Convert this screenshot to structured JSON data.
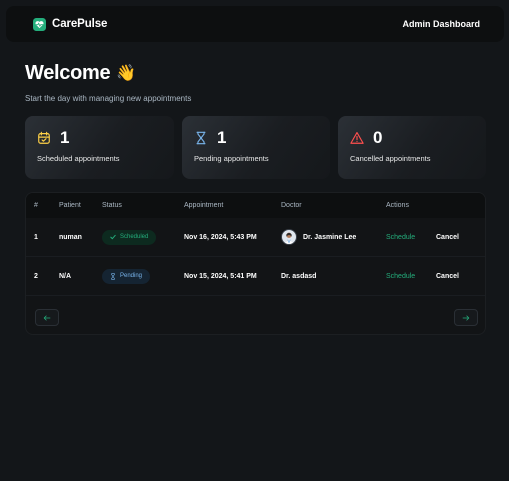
{
  "header": {
    "app_name": "CarePulse",
    "right_title": "Admin Dashboard"
  },
  "welcome": {
    "title": "Welcome",
    "icon": "waving-hand-icon",
    "subtitle": "Start the day with managing new appointments"
  },
  "stats": [
    {
      "icon": "calendar-check-icon",
      "count": "1",
      "label": "Scheduled appointments",
      "color": "#ffd147"
    },
    {
      "icon": "hourglass-icon",
      "count": "1",
      "label": "Pending appointments",
      "color": "#79b5ec"
    },
    {
      "icon": "alert-triangle-icon",
      "count": "0",
      "label": "Cancelled appointments",
      "color": "#ff4f4e"
    }
  ],
  "table": {
    "headers": {
      "num": "#",
      "patient": "Patient",
      "status": "Status",
      "appointment": "Appointment",
      "doctor": "Doctor",
      "actions": "Actions"
    },
    "rows": [
      {
        "num": "1",
        "patient": "numan",
        "status": "Scheduled",
        "status_icon": "check-icon",
        "appointment": "Nov 16, 2024, 5:43 PM",
        "doctor": "Dr. Jasmine Lee",
        "has_avatar": true,
        "action_schedule": "Schedule",
        "action_cancel": "Cancel"
      },
      {
        "num": "2",
        "patient": "N/A",
        "status": "Pending",
        "status_icon": "hourglass-icon",
        "appointment": "Nov 15, 2024, 5:41 PM",
        "doctor": "Dr. asdasd",
        "has_avatar": false,
        "action_schedule": "Schedule",
        "action_cancel": "Cancel"
      }
    ],
    "pagination": {
      "prev_icon": "arrow-left-icon",
      "next_icon": "arrow-right-icon"
    }
  },
  "colors": {
    "accent_green": "#24ae7c",
    "pending_blue": "#79b5ec",
    "warning_red": "#ff4f4e",
    "calendar_yellow": "#ffd147"
  }
}
